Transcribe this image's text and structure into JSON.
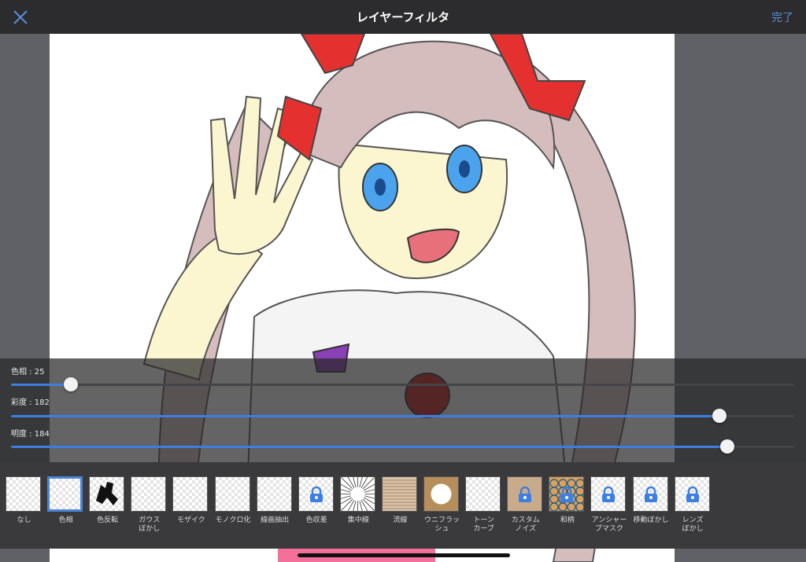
{
  "header": {
    "title": "レイヤーフィルタ",
    "done_label": "完了",
    "close_icon": "close-x-icon"
  },
  "colors": {
    "accent": "#3d7ee3",
    "topbar": "#2c2c2e",
    "panel": "#3a3a3c"
  },
  "sliders": [
    {
      "label": "色相 : 25",
      "fraction": 0.076
    },
    {
      "label": "彩度 : 182",
      "fraction": 0.905
    },
    {
      "label": "明度 : 184",
      "fraction": 0.915
    }
  ],
  "filters": [
    {
      "label": "なし",
      "thumb": "plain",
      "locked": false,
      "selected": false
    },
    {
      "label": "色相",
      "thumb": "plain",
      "locked": false,
      "selected": true
    },
    {
      "label": "色反転",
      "thumb": "invert",
      "locked": false,
      "selected": false
    },
    {
      "label": "ガウス\nぼかし",
      "thumb": "plain",
      "locked": false,
      "selected": false
    },
    {
      "label": "モザイク",
      "thumb": "plain",
      "locked": false,
      "selected": false
    },
    {
      "label": "モノクロ化",
      "thumb": "plain",
      "locked": false,
      "selected": false
    },
    {
      "label": "線画抽出",
      "thumb": "plain",
      "locked": false,
      "selected": false
    },
    {
      "label": "色収差",
      "thumb": "plain",
      "locked": true,
      "selected": false
    },
    {
      "label": "集中線",
      "thumb": "burst",
      "locked": false,
      "selected": false
    },
    {
      "label": "流線",
      "thumb": "streak",
      "locked": false,
      "selected": false
    },
    {
      "label": "ウニフラッ\nシュ",
      "thumb": "flash",
      "locked": false,
      "selected": false
    },
    {
      "label": "トーン\nカーブ",
      "thumb": "plain",
      "locked": false,
      "selected": false
    },
    {
      "label": "カスタム\nノイズ",
      "thumb": "noise",
      "locked": true,
      "selected": false
    },
    {
      "label": "和柄",
      "thumb": "pattern",
      "locked": true,
      "selected": false
    },
    {
      "label": "アンシャー\nプマスク",
      "thumb": "plain",
      "locked": true,
      "selected": false
    },
    {
      "label": "移動ぼかし",
      "thumb": "plain",
      "locked": true,
      "selected": false
    },
    {
      "label": "レンズ\nぼかし",
      "thumb": "plain",
      "locked": true,
      "selected": false
    }
  ]
}
